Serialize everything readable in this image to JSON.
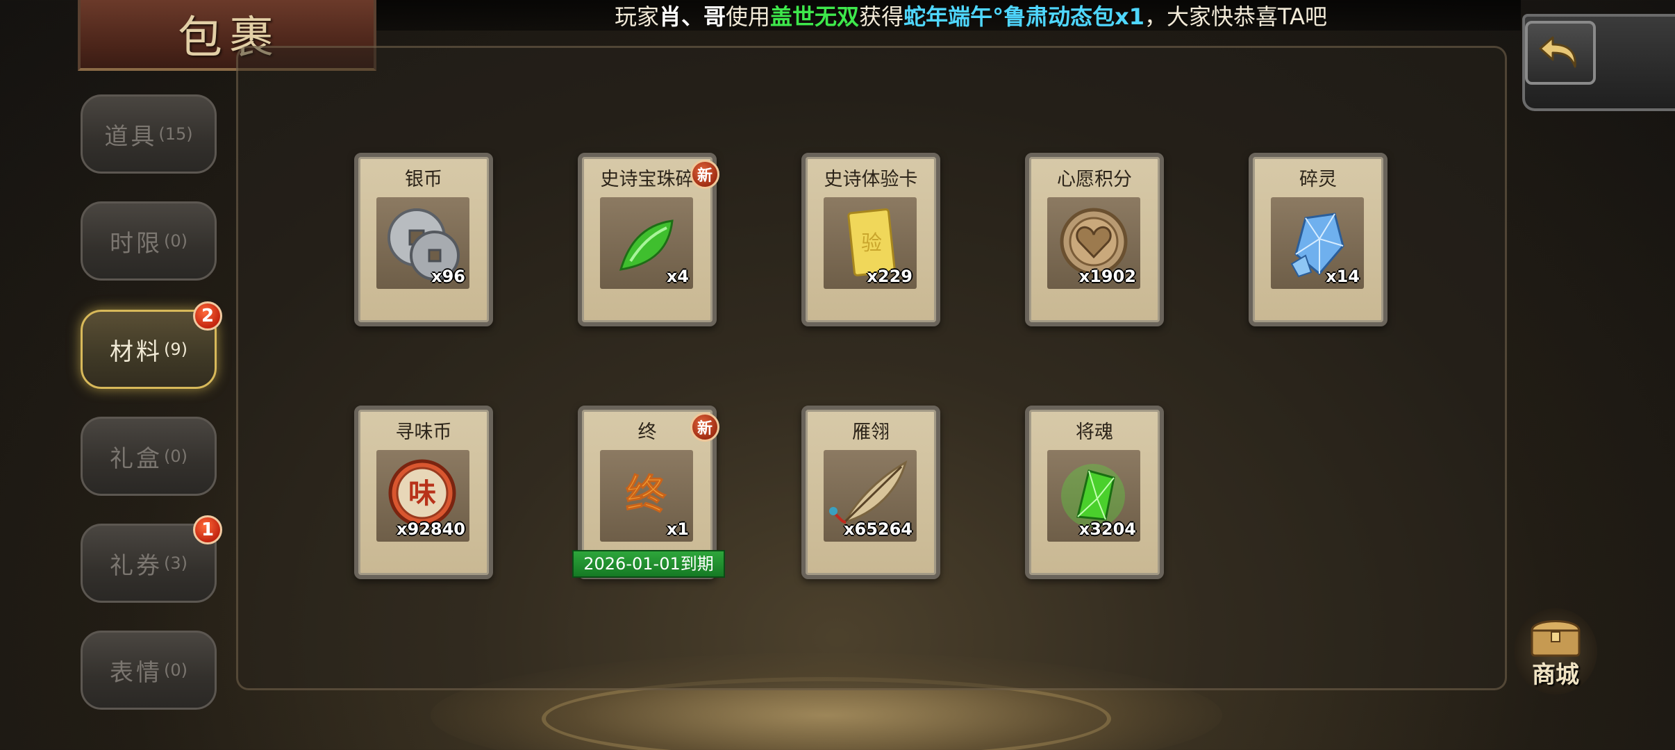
{
  "ticker": {
    "p1": "玩家",
    "player": "肖、哥",
    "p2": "使用",
    "source": "盖世无双",
    "p3": "获得",
    "reward": "蛇年端午°鲁肃动态包x1",
    "p4": "，大家快恭喜TA吧"
  },
  "title": "包裹",
  "tabs": [
    {
      "label": "道具",
      "count": "(15)",
      "active": false
    },
    {
      "label": "时限",
      "count": "(0)",
      "active": false
    },
    {
      "label": "材料",
      "count": "(9)",
      "active": true,
      "badge": "2"
    },
    {
      "label": "礼盒",
      "count": "(0)",
      "active": false
    },
    {
      "label": "礼券",
      "count": "(3)",
      "active": false,
      "badge": "1"
    },
    {
      "label": "表情",
      "count": "(0)",
      "active": false
    }
  ],
  "items": [
    {
      "name": "银币",
      "qty": "x96",
      "icon": "silver-coin-icon"
    },
    {
      "name": "史诗宝珠碎",
      "qty": "x4",
      "icon": "green-shard-icon",
      "new": "新"
    },
    {
      "name": "史诗体验卡",
      "qty": "x229",
      "icon": "gold-card-icon",
      "card_glyph": "验"
    },
    {
      "name": "心愿积分",
      "qty": "x1902",
      "icon": "heart-coin-icon"
    },
    {
      "name": "碎灵",
      "qty": "x14",
      "icon": "blue-crystal-icon"
    },
    {
      "name": "寻味币",
      "qty": "x92840",
      "icon": "taste-coin-icon",
      "coin_glyph": "味"
    },
    {
      "name": "终",
      "qty": "x1",
      "icon": "zhong-glyph-icon",
      "glyph": "终",
      "new": "新",
      "expiry": "2026-01-01到期"
    },
    {
      "name": "雁翎",
      "qty": "x65264",
      "icon": "feather-icon"
    },
    {
      "name": "将魂",
      "qty": "x3204",
      "icon": "green-soul-crystal-icon"
    }
  ],
  "shop_label": "商城",
  "colors": {
    "highlight_green": "#3ee84c",
    "highlight_cyan": "#4fd7ff",
    "active_tab_border": "#d8b95a",
    "badge_red": "#c3250f",
    "expiry_green": "#2ea63b"
  }
}
